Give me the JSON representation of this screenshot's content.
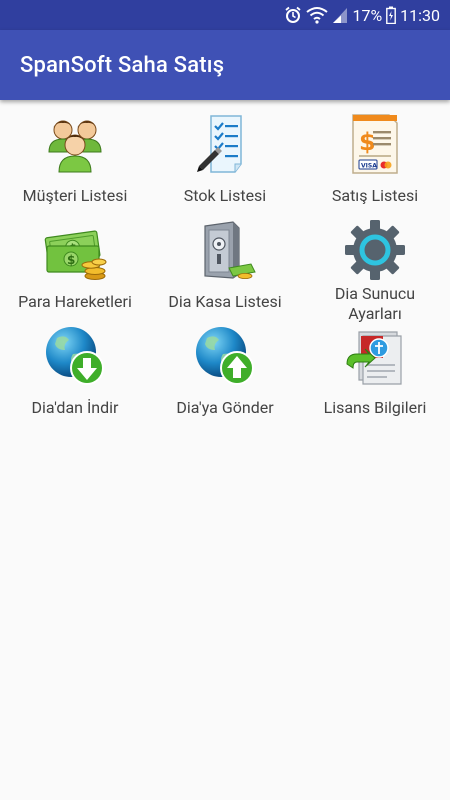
{
  "status_bar": {
    "battery": "17%",
    "time": "11:30"
  },
  "app_bar": {
    "title": "SpanSoft Saha Satış"
  },
  "menu": {
    "items": [
      {
        "label": "Müşteri Listesi",
        "icon": "customers-icon"
      },
      {
        "label": "Stok Listesi",
        "icon": "stock-checklist-icon"
      },
      {
        "label": "Satış Listesi",
        "icon": "sales-invoice-icon"
      },
      {
        "label": "Para Hareketleri",
        "icon": "money-icon"
      },
      {
        "label": "Dia Kasa Listesi",
        "icon": "safe-icon"
      },
      {
        "label_line1": "Dia Sunucu",
        "label_line2": "Ayarları",
        "icon": "gear-icon"
      },
      {
        "label": "Dia'dan İndir",
        "icon": "globe-download-icon"
      },
      {
        "label": "Dia'ya Gönder",
        "icon": "globe-upload-icon"
      },
      {
        "label": "Lisans Bilgileri",
        "icon": "license-icon"
      }
    ]
  }
}
